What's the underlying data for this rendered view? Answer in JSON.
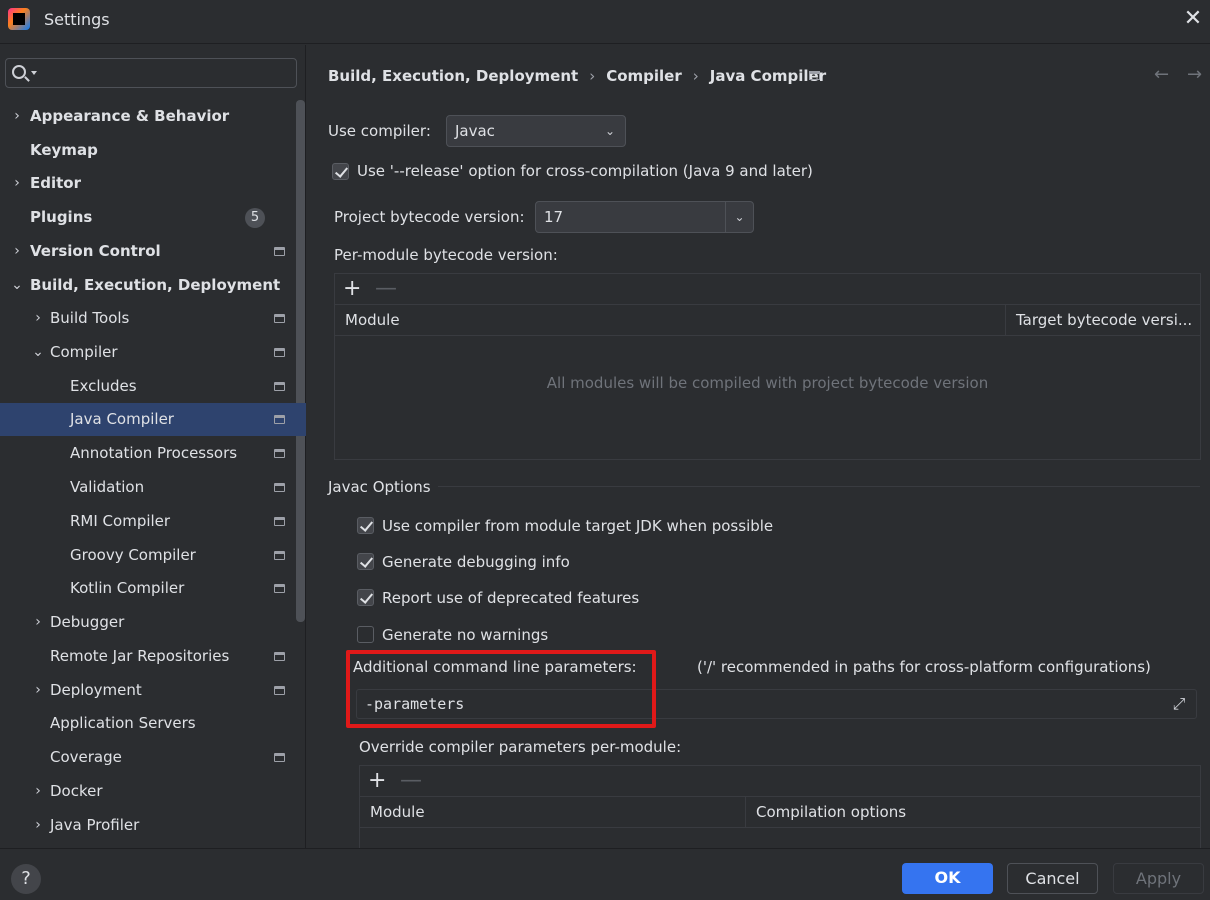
{
  "window": {
    "title": "Settings",
    "close_label": "✕"
  },
  "search": {
    "placeholder": ""
  },
  "sidebar": {
    "items": [
      {
        "label": "Appearance & Behavior",
        "expander": "›"
      },
      {
        "label": "Keymap"
      },
      {
        "label": "Editor",
        "expander": "›"
      },
      {
        "label": "Plugins",
        "badge": "5"
      },
      {
        "label": "Version Control",
        "expander": "›"
      },
      {
        "label": "Build, Execution, Deployment",
        "expander": "⌄"
      },
      {
        "label": "Build Tools",
        "expander": "›"
      },
      {
        "label": "Compiler",
        "expander": "⌄"
      },
      {
        "label": "Excludes"
      },
      {
        "label": "Java Compiler"
      },
      {
        "label": "Annotation Processors"
      },
      {
        "label": "Validation"
      },
      {
        "label": "RMI Compiler"
      },
      {
        "label": "Groovy Compiler"
      },
      {
        "label": "Kotlin Compiler"
      },
      {
        "label": "Debugger",
        "expander": "›"
      },
      {
        "label": "Remote Jar Repositories"
      },
      {
        "label": "Deployment",
        "expander": "›"
      },
      {
        "label": "Application Servers"
      },
      {
        "label": "Coverage"
      },
      {
        "label": "Docker",
        "expander": "›"
      },
      {
        "label": "Java Profiler",
        "expander": "›"
      }
    ]
  },
  "breadcrumb": {
    "items": [
      "Build, Execution, Deployment",
      "Compiler",
      "Java Compiler"
    ],
    "separator": "›"
  },
  "nav": {
    "back": "←",
    "forward": "→"
  },
  "compiler": {
    "use_compiler_label": "Use compiler:",
    "use_compiler_value": "Javac",
    "release_option_label": "Use '--release' option for cross-compilation (Java 9 and later)",
    "release_option_checked": true,
    "bytecode_label": "Project bytecode version:",
    "bytecode_value": "17",
    "per_module_label": "Per-module bytecode version:",
    "per_module_table": {
      "columns": [
        "Module",
        "Target bytecode versi..."
      ],
      "empty_text": "All modules will be compiled with project bytecode version"
    }
  },
  "javac": {
    "section_title": "Javac Options",
    "options": [
      {
        "label": "Use compiler from module target JDK when possible",
        "checked": true
      },
      {
        "label": "Generate debugging info",
        "checked": true
      },
      {
        "label": "Report use of deprecated features",
        "checked": true
      },
      {
        "label": "Generate no warnings",
        "checked": false
      }
    ],
    "params_label": "Additional command line parameters:",
    "params_hint": "('/' recommended in paths for cross-platform configurations)",
    "params_value": "-parameters",
    "override_label": "Override compiler parameters per-module:",
    "override_table": {
      "columns": [
        "Module",
        "Compilation options"
      ]
    }
  },
  "toolbar": {
    "plus": "+",
    "minus": "—"
  },
  "footer": {
    "help": "?",
    "ok": "OK",
    "cancel": "Cancel",
    "apply": "Apply"
  },
  "colors": {
    "accent": "#3574f0",
    "selection": "#2e436e",
    "highlight": "#e01919"
  }
}
